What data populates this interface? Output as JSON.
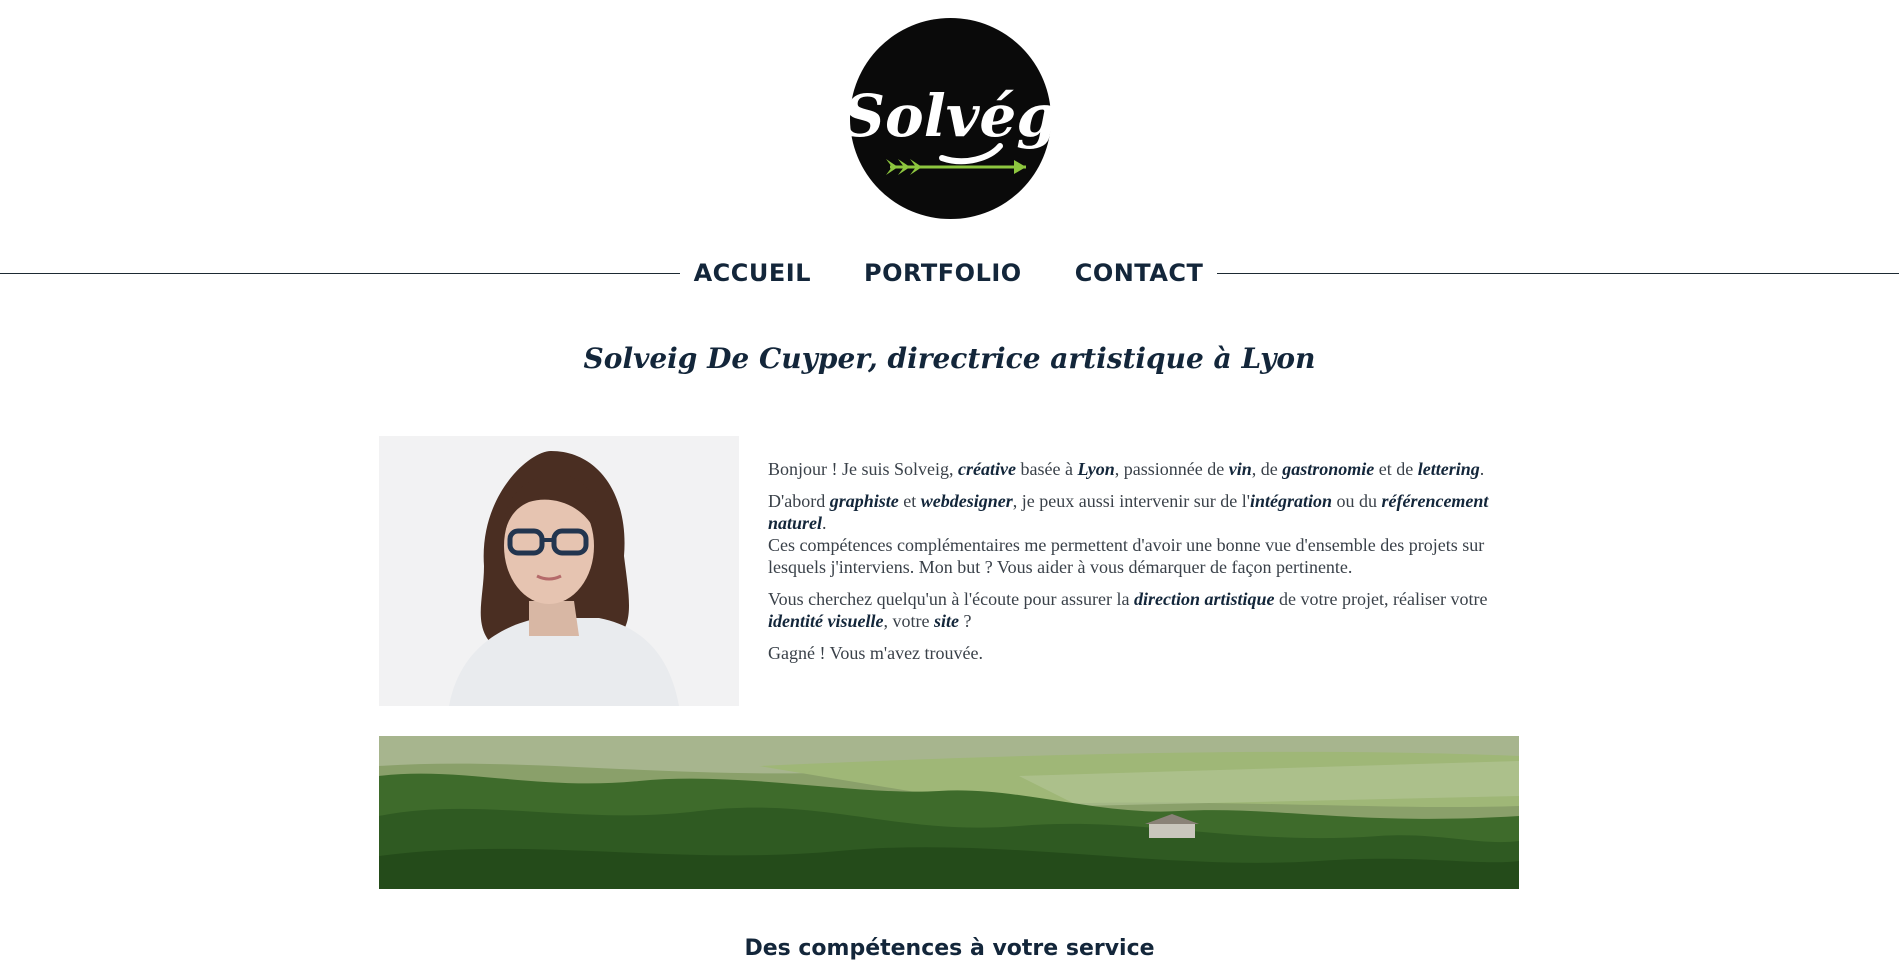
{
  "logo": {
    "text": "Solvég",
    "accent": "#8dc63f",
    "background": "#0a0a0a"
  },
  "nav": {
    "items": [
      {
        "label": "ACCUEIL"
      },
      {
        "label": "PORTFOLIO"
      },
      {
        "label": "CONTACT"
      }
    ]
  },
  "page_title": "Solveig De Cuyper, directrice artistique à Lyon",
  "intro": {
    "p1": {
      "t1": "Bonjour ! Je suis Solveig, ",
      "b1": "créative",
      "t2": " basée à ",
      "b2": "Lyon",
      "t3": ", passionnée de ",
      "b3": "vin",
      "t4": ", de ",
      "b4": "gastronomie",
      "t5": " et de ",
      "b5": "lettering",
      "t6": "."
    },
    "p2": {
      "t1": "D'abord ",
      "b1": "graphiste",
      "t2": " et ",
      "b2": "webdesigner",
      "t3": ", je peux aussi intervenir sur de l'",
      "b3": "intégration",
      "t4": " ou du ",
      "b4": "référencement naturel",
      "t5": "."
    },
    "p3": "Ces compétences complémentaires me permettent d'avoir une bonne vue d'ensemble des projets sur lesquels j'interviens. Mon but ? Vous aider à vous démarquer de façon pertinente.",
    "p4": {
      "t1": "Vous cherchez quelqu'un à l'écoute pour assurer la ",
      "b1": "direction artistique",
      "t2": " de votre projet, réaliser votre ",
      "b2": "identité visuelle",
      "t3": ", votre ",
      "b3": "site",
      "t4": " ?"
    },
    "p5": "Gagné ! Vous m'avez trouvée."
  },
  "section_title": "Des compétences à votre service",
  "colors": {
    "navy": "#13263a",
    "text": "#3a4149",
    "rule": "#1d2a33"
  }
}
